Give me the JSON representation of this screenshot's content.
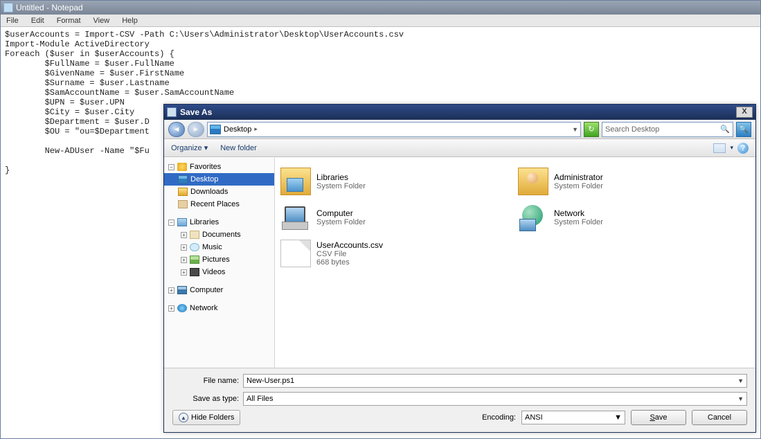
{
  "notepad": {
    "title": "Untitled - Notepad",
    "menu": [
      "File",
      "Edit",
      "Format",
      "View",
      "Help"
    ],
    "content": "$userAccounts = Import-CSV -Path C:\\Users\\Administrator\\Desktop\\UserAccounts.csv\nImport-Module ActiveDirectory\nForeach ($user in $userAccounts) {\n        $FullName = $user.FullName\n        $GivenName = $user.FirstName\n        $Surname = $user.Lastname\n        $SamAccountName = $user.SamAccountName\n        $UPN = $user.UPN\n        $City = $user.City\n        $Department = $user.D\n        $OU = \"ou=$Department\n\n        New-ADUser -Name \"$Fu\n\n}"
  },
  "saveAs": {
    "title": "Save As",
    "close": "X",
    "location": "Desktop",
    "searchPlaceholder": "Search Desktop",
    "organize": "Organize",
    "newFolder": "New folder",
    "tree": {
      "favorites": {
        "label": "Favorites",
        "items": [
          {
            "label": "Desktop",
            "icon": "ico-desktop",
            "selected": true
          },
          {
            "label": "Downloads",
            "icon": "ico-downloads"
          },
          {
            "label": "Recent Places",
            "icon": "ico-recent"
          }
        ]
      },
      "libraries": {
        "label": "Libraries",
        "items": [
          {
            "label": "Documents",
            "icon": "ico-doc"
          },
          {
            "label": "Music",
            "icon": "ico-music"
          },
          {
            "label": "Pictures",
            "icon": "ico-pic"
          },
          {
            "label": "Videos",
            "icon": "ico-video"
          }
        ]
      },
      "computer": {
        "label": "Computer"
      },
      "network": {
        "label": "Network"
      }
    },
    "files": [
      {
        "name": "Libraries",
        "sub1": "System Folder",
        "sub2": "",
        "icon": "ico-libraries"
      },
      {
        "name": "Administrator",
        "sub1": "System Folder",
        "sub2": "",
        "icon": "ico-admin"
      },
      {
        "name": "Computer",
        "sub1": "System Folder",
        "sub2": "",
        "icon": "ico-computerbig"
      },
      {
        "name": "Network",
        "sub1": "System Folder",
        "sub2": "",
        "icon": "ico-networkbig"
      },
      {
        "name": "UserAccounts.csv",
        "sub1": "CSV File",
        "sub2": "668 bytes",
        "icon": "ico-csv"
      }
    ],
    "fileNameLabel": "File name:",
    "fileNameValue": "New-User.ps1",
    "saveTypeLabel": "Save as type:",
    "saveTypeValue": "All Files",
    "hideFolders": "Hide Folders",
    "encodingLabel": "Encoding:",
    "encodingValue": "ANSI",
    "save": "Save",
    "cancel": "Cancel"
  }
}
